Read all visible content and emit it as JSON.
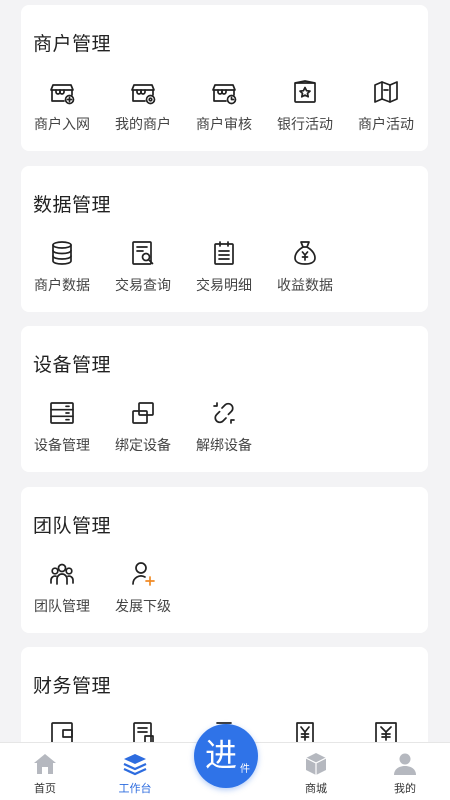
{
  "sections": [
    {
      "title": "商户管理",
      "items": [
        {
          "label": "商户入网",
          "icon": "store-add-icon"
        },
        {
          "label": "我的商户",
          "icon": "store-gear-icon"
        },
        {
          "label": "商户审核",
          "icon": "store-clock-icon"
        },
        {
          "label": "银行活动",
          "icon": "bank-star-icon"
        },
        {
          "label": "商户活动",
          "icon": "map-activity-icon"
        }
      ]
    },
    {
      "title": "数据管理",
      "items": [
        {
          "label": "商户数据",
          "icon": "database-icon"
        },
        {
          "label": "交易查询",
          "icon": "search-doc-icon"
        },
        {
          "label": "交易明细",
          "icon": "clipboard-list-icon"
        },
        {
          "label": "收益数据",
          "icon": "money-bag-icon"
        }
      ]
    },
    {
      "title": "设备管理",
      "items": [
        {
          "label": "设备管理",
          "icon": "server-icon"
        },
        {
          "label": "绑定设备",
          "icon": "link-icon"
        },
        {
          "label": "解绑设备",
          "icon": "unlink-icon"
        }
      ]
    },
    {
      "title": "团队管理",
      "items": [
        {
          "label": "团队管理",
          "icon": "team-icon"
        },
        {
          "label": "发展下级",
          "icon": "add-user-icon"
        }
      ]
    },
    {
      "title": "财务管理",
      "items": [
        {
          "label": "",
          "icon": "wallet-icon"
        },
        {
          "label": "",
          "icon": "bill-icon"
        },
        {
          "label": "",
          "icon": "doc-icon"
        },
        {
          "label": "",
          "icon": "yen-doc-icon"
        },
        {
          "label": "",
          "icon": "yen-box-icon"
        }
      ]
    }
  ],
  "tabbar": {
    "tabs": [
      {
        "label": "首页",
        "icon": "home-icon"
      },
      {
        "label": "工作台",
        "icon": "layers-icon"
      },
      {
        "label": "商城",
        "icon": "cube-icon"
      },
      {
        "label": "我的",
        "icon": "user-icon"
      }
    ],
    "center": {
      "main": "进",
      "sub": "件"
    },
    "active_color": "#2d6cdf"
  }
}
